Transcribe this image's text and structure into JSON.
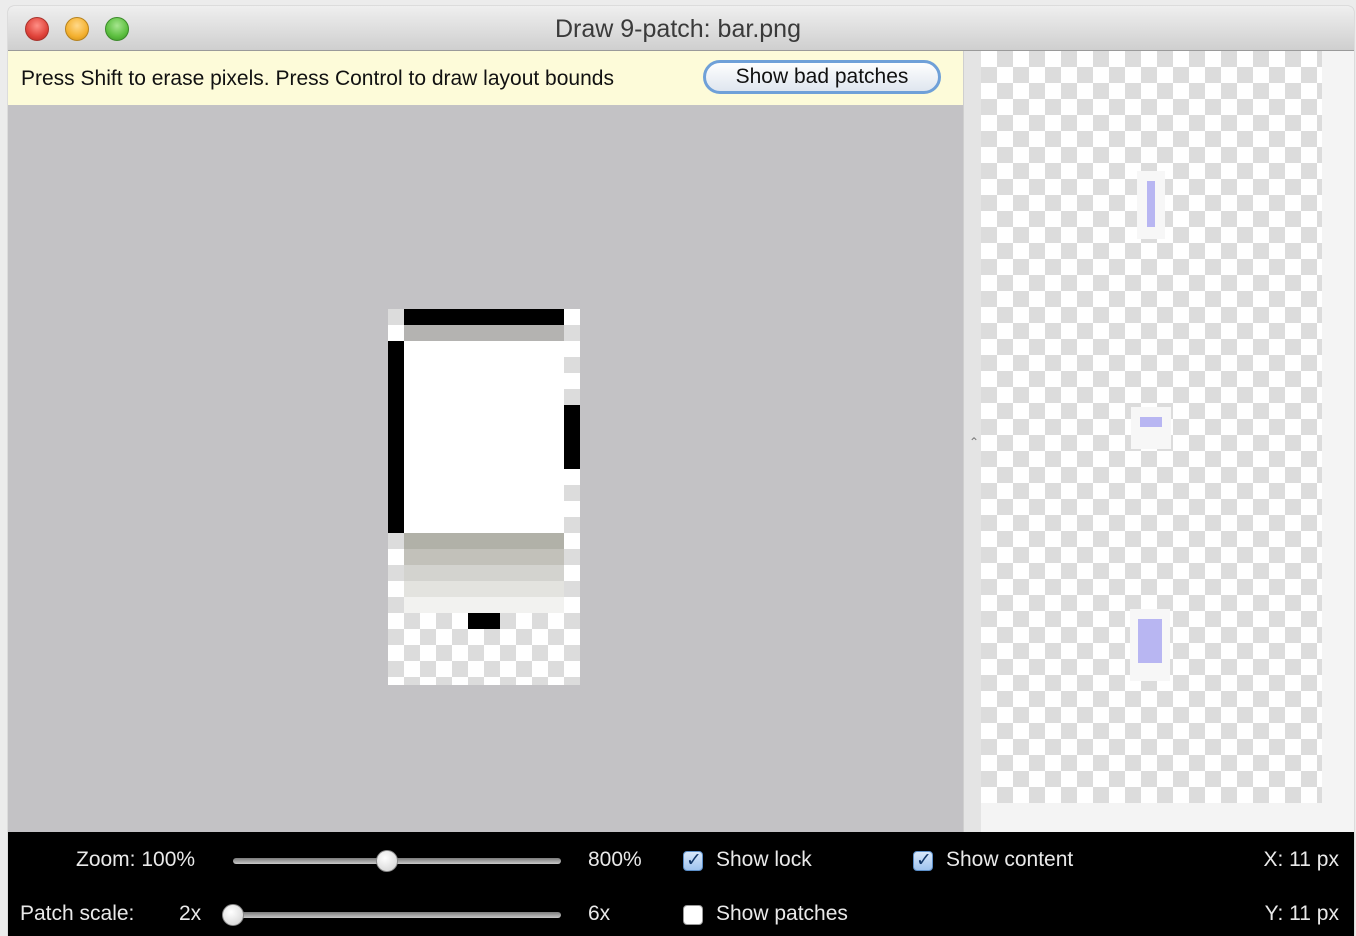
{
  "window": {
    "title": "Draw 9-patch: bar.png"
  },
  "infobar": {
    "hint": "Press Shift to erase pixels. Press Control to draw layout bounds",
    "bad_patches_button": "Show bad patches"
  },
  "controls": {
    "zoom_label": "Zoom: 100%",
    "zoom_max": "800%",
    "zoom_value": 0.47,
    "patch_scale_label": "Patch scale:",
    "patch_scale_min": "2x",
    "patch_scale_max": "6x",
    "patch_scale_value": 0.0,
    "show_lock": {
      "label": "Show lock",
      "checked": true
    },
    "show_content": {
      "label": "Show content",
      "checked": true
    },
    "show_patches": {
      "label": "Show patches",
      "checked": false
    },
    "x_readout": "X: 11 px",
    "y_readout": "Y: 11 px"
  },
  "colors": {
    "editor_bg": "#c3c2c5",
    "infobar_bg": "#fdfbd9",
    "content_fill": "#b8b6f2",
    "button_border": "#6fa0d8"
  }
}
